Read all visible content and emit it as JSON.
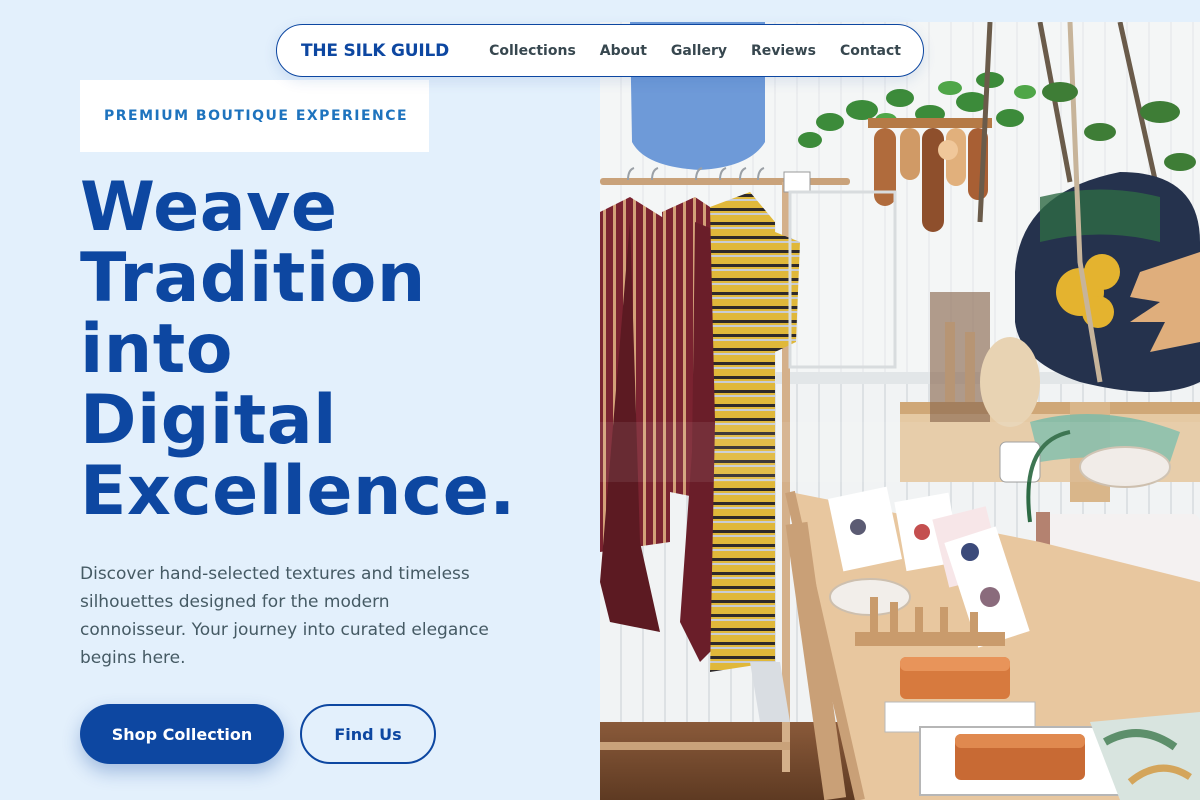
{
  "nav": {
    "brand": "THE SILK GUILD",
    "links": [
      "Collections",
      "About",
      "Gallery",
      "Reviews",
      "Contact"
    ]
  },
  "hero": {
    "eyebrow": "PREMIUM BOUTIQUE EXPERIENCE",
    "headline_lines": [
      "Weave",
      "Tradition",
      "into",
      "Digital",
      "Excellence."
    ],
    "lead_lines": [
      "Discover hand-selected textures and timeless",
      "silhouettes designed for the modern",
      "connoisseur. Your journey into curated elegance",
      "begins here."
    ],
    "primary_cta": "Shop Collection",
    "secondary_cta": "Find Us",
    "image_alt": "Boutique interior with clothing racks, handbags and display tables"
  },
  "colors": {
    "page_bg": "#e3f0fc",
    "brand_blue": "#0d47a1",
    "eyebrow_text": "#1e73be",
    "body_text": "#455a64"
  }
}
